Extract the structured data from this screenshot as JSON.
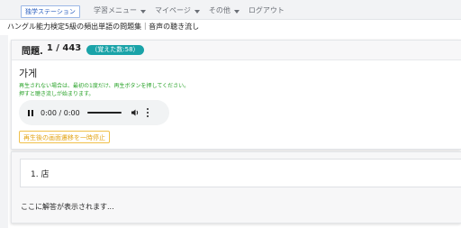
{
  "nav": {
    "brand": "独学ステーション",
    "items": [
      {
        "label": "学習メニュー",
        "has_caret": true
      },
      {
        "label": "マイページ",
        "has_caret": true
      },
      {
        "label": "その他",
        "has_caret": true
      },
      {
        "label": "ログアウト",
        "has_caret": false
      }
    ]
  },
  "page": {
    "subtitle": "ハングル能力検定5級の頻出単語の問題集｜音声の聴き流し"
  },
  "question": {
    "label": "問題.",
    "progress": "1 / 443",
    "memorized_badge": "覚えた数:58",
    "word": "가게",
    "hint_line1": "再生されない場合は、最初の1度だけ、再生ボタンを押してください。",
    "hint_line2": "押すと聴き流しが始まります。",
    "audio_time": "0:00 / 0:00",
    "pause_toggle_label": "再生後の画面遷移を一時停止"
  },
  "answer": {
    "choice": "1. 店",
    "placeholder": "ここに解答が表示されます..."
  },
  "colors": {
    "brand_blue": "#2b5fbf",
    "badge_teal": "#1aa3a8",
    "hint_green": "#2aa32a",
    "toggle_orange": "#e3a418"
  },
  "icons": [
    "pause-icon",
    "volume-icon",
    "more-vertical-icon",
    "chevron-down-icon"
  ]
}
